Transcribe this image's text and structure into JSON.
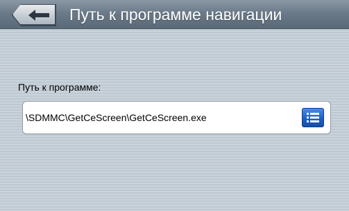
{
  "header": {
    "title": "Путь к программе навигации",
    "back_icon": "back-arrow-icon"
  },
  "path": {
    "label": "Путь к программе:",
    "value": "\\SDMMC\\GetCeScreen\\GetCeScreen.exe",
    "browse_icon": "list-icon"
  },
  "colors": {
    "header_gradient_top": "#8b98a6",
    "header_gradient_bottom": "#5a6977",
    "background": "#c7d0d8",
    "browse_button": "#1f5fc4"
  }
}
